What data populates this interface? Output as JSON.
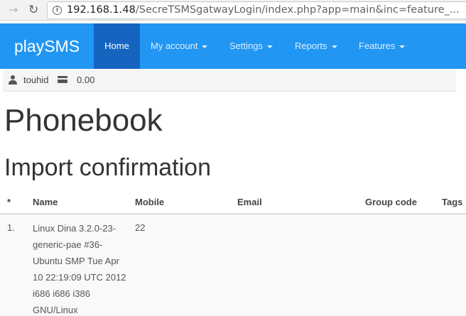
{
  "browser": {
    "url_host": "192.168.1.48",
    "url_rest": "/SecreTSMSgatwayLogin/index.php?app=main&inc=feature_..."
  },
  "app": {
    "brand": "playSMS",
    "nav": [
      {
        "label": "Home",
        "active": true
      },
      {
        "label": "My account",
        "dropdown": true
      },
      {
        "label": "Settings",
        "dropdown": true
      },
      {
        "label": "Reports",
        "dropdown": true
      },
      {
        "label": "Features",
        "dropdown": true
      }
    ],
    "accent_color": "#2196f3",
    "active_color": "#1565c0"
  },
  "user": {
    "username": "touhid",
    "credit": "0.00",
    "icons": [
      "user-icon",
      "credit-card-icon"
    ]
  },
  "page": {
    "title": "Phonebook",
    "subtitle": "Import confirmation"
  },
  "table": {
    "headers": [
      "*",
      "Name",
      "Mobile",
      "Email",
      "Group code",
      "Tags"
    ],
    "rows": [
      {
        "index": "1.",
        "name_lines": [
          "Linux Dina 3.2.0-23-",
          "generic-pae #36-",
          "Ubuntu SMP Tue Apr",
          "10 22:19:09 UTC 2012",
          "i686 i686 i386",
          "GNU/Linux"
        ],
        "mobile": "22",
        "email": "",
        "group_code": "",
        "tags": ""
      }
    ]
  }
}
